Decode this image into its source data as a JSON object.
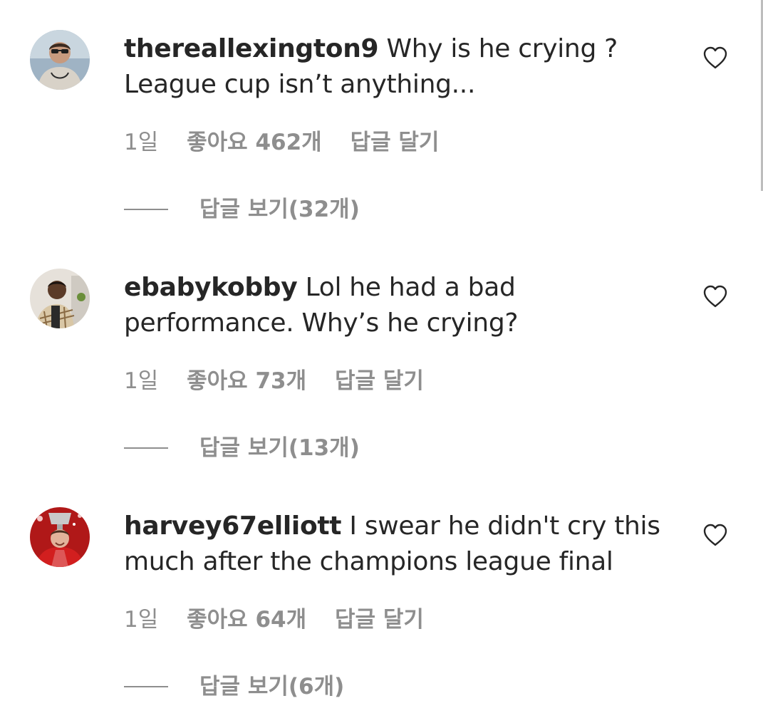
{
  "comments": [
    {
      "username": "thereallexington9",
      "text": "Why is he crying ? League cup isn’t anything...",
      "time": "1일",
      "likes": "좋아요 462개",
      "reply": "답글 달기",
      "view_replies": "답글 보기(32개)",
      "avatar_icon": "profile-photo",
      "like_icon": "heart-outline-icon"
    },
    {
      "username": "ebabykobby",
      "text": "Lol he had a bad performance. Why’s he crying?",
      "time": "1일",
      "likes": "좋아요 73개",
      "reply": "답글 달기",
      "view_replies": "답글 보기(13개)",
      "avatar_icon": "profile-photo",
      "like_icon": "heart-outline-icon"
    },
    {
      "username": "harvey67elliott",
      "text": "I swear he didn't cry this much after the champions league final",
      "time": "1일",
      "likes": "좋아요 64개",
      "reply": "답글 달기",
      "view_replies": "답글 보기(6개)",
      "avatar_icon": "profile-photo",
      "like_icon": "heart-outline-icon"
    }
  ],
  "colors": {
    "text": "#262626",
    "secondary": "#8e8e8e",
    "background": "#ffffff"
  }
}
